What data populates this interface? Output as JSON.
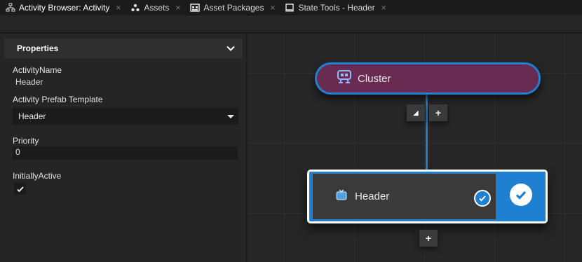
{
  "tabs": [
    {
      "label": "Activity Browser: Activity",
      "icon": "hierarchy-icon",
      "active": true
    },
    {
      "label": "Assets",
      "icon": "assets-icon"
    },
    {
      "label": "Asset Packages",
      "icon": "asset-packages-icon"
    },
    {
      "label": "State Tools - Header",
      "icon": "monitor-icon"
    }
  ],
  "tab_close_glyph": "×",
  "properties": {
    "title": "Properties",
    "activity_name_label": "ActivityName",
    "activity_name_value": "Header",
    "prefab_template_label": "Activity Prefab Template",
    "prefab_template_value": "Header",
    "priority_label": "Priority",
    "priority_value": "0",
    "initially_active_label": "InitiallyActive",
    "initially_active_checked": true
  },
  "graph": {
    "cluster_node": {
      "label": "Cluster",
      "icon": "cluster-icon"
    },
    "header_node": {
      "label": "Header",
      "icon": "screen-icon",
      "active": true
    },
    "collapse_glyph": "◢",
    "add_glyph": "+"
  },
  "colors": {
    "accent": "#1f7fd0",
    "cluster_fill": "#6a2b53",
    "panel_bg": "#252525",
    "canvas_bg": "#262626"
  }
}
